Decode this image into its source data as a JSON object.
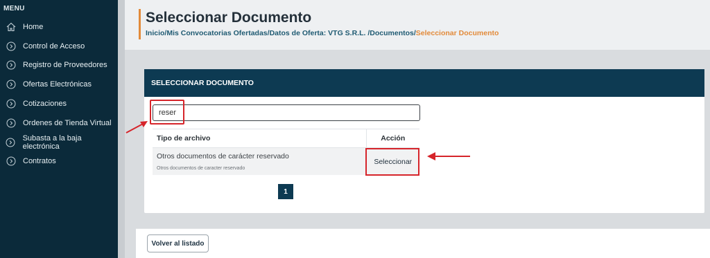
{
  "sidebar": {
    "menu_title": "MENU",
    "items": [
      {
        "label": "Home",
        "icon": "home-icon"
      },
      {
        "label": "Control de Acceso",
        "icon": "chevron-circle-icon"
      },
      {
        "label": "Registro de Proveedores",
        "icon": "chevron-circle-icon"
      },
      {
        "label": "Ofertas Electrónicas",
        "icon": "chevron-circle-icon"
      },
      {
        "label": "Cotizaciones",
        "icon": "chevron-circle-icon"
      },
      {
        "label": "Ordenes de Tienda Virtual",
        "icon": "chevron-circle-icon"
      },
      {
        "label": "Subasta a la baja electrónica",
        "icon": "chevron-circle-icon"
      },
      {
        "label": "Contratos",
        "icon": "chevron-circle-icon"
      }
    ]
  },
  "header": {
    "title": "Seleccionar Documento",
    "breadcrumb": {
      "inicio": "Inicio",
      "convocatorias": "Mis Convocatorias Ofertadas",
      "datos": "Datos de Oferta: VTG S.R.L. ",
      "documentos": "Documentos",
      "current": "Seleccionar Documento",
      "sep": "/"
    }
  },
  "card": {
    "title": "SELECCIONAR DOCUMENTO",
    "search_value": "reser",
    "table": {
      "col_type": "Tipo de archivo",
      "col_action": "Acción",
      "rows": [
        {
          "title": "Otros documentos de carácter reservado",
          "subtitle": "Otros documentos de caracter reservado",
          "action": "Seleccionar"
        }
      ]
    },
    "pagination": {
      "current_page": "1"
    }
  },
  "footer": {
    "back_label": "Volver al listado"
  },
  "colors": {
    "sidebar_bg": "#0b2a3a",
    "header_dark": "#0d3a52",
    "accent_orange": "#e28a3a",
    "annotation_red": "#d6242a"
  }
}
